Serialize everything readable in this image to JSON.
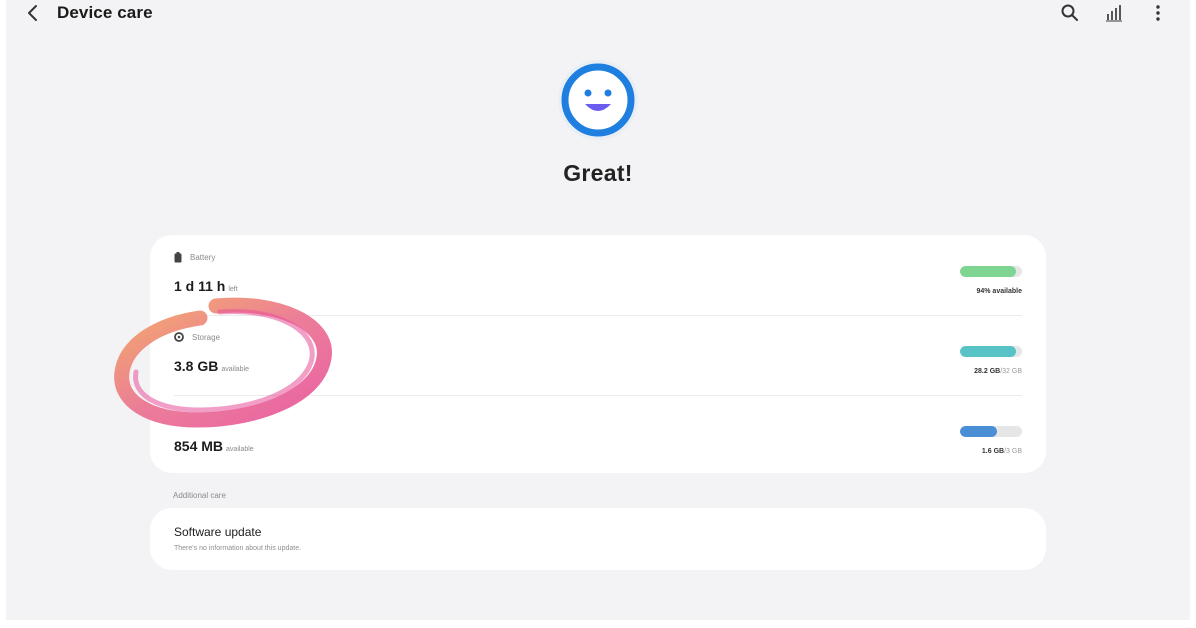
{
  "appbar": {
    "title": "Device care",
    "back_icon": "chevron-left-icon",
    "actions": [
      {
        "name": "search-icon"
      },
      {
        "name": "stats-icon"
      },
      {
        "name": "more-vert-icon"
      }
    ]
  },
  "status": {
    "icon": "smiley-face-icon",
    "text": "Great!"
  },
  "rows": {
    "battery": {
      "label": "Battery",
      "value": "1 d 11 h",
      "suffix": "left",
      "meta_main": "94% available",
      "meta_muted": "",
      "fill_fraction": 0.9,
      "color": "#7ed491"
    },
    "storage": {
      "label": "Storage",
      "value": "3.8 GB",
      "suffix": "available",
      "meta_main": "28.2 GB",
      "meta_muted": "/32 GB",
      "fill_fraction": 0.9,
      "color": "#57c3c6"
    },
    "memory": {
      "label": "",
      "value": "854 MB",
      "suffix": "available",
      "meta_main": "1.6 GB",
      "meta_muted": "/3 GB",
      "fill_fraction": 0.6,
      "color": "#4a8fd6"
    }
  },
  "additional": {
    "header": "Additional care",
    "software_update": {
      "title": "Software update",
      "subtitle": "There's no information about this update."
    }
  },
  "colors": {
    "accent_blue": "#1f7fe0",
    "smiley_mouth": "#6a5cf0",
    "annotation_pink": "#e7509a",
    "annotation_orange": "#f3a35a"
  }
}
